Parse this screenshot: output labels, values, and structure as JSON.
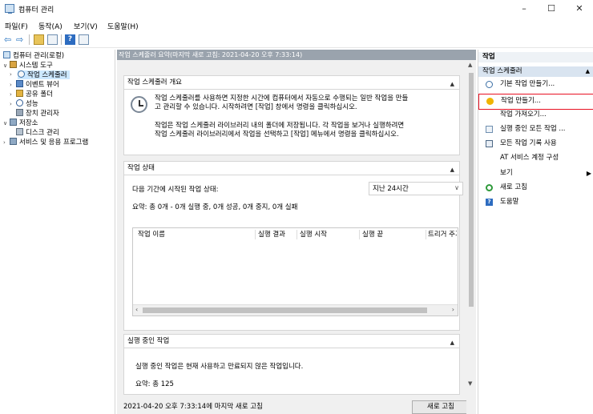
{
  "window": {
    "title": "컴퓨터 관리",
    "controls": [
      "–",
      "☐",
      "✕"
    ]
  },
  "menu": [
    "파일(F)",
    "동작(A)",
    "보기(V)",
    "도움말(H)"
  ],
  "tree": [
    {
      "label": "컴퓨터 관리(로컬)",
      "level": 0
    },
    {
      "label": "시스템 도구",
      "level": 1,
      "arrow": "∨"
    },
    {
      "label": "작업 스케줄러",
      "level": 2,
      "arrow": "›",
      "selected": true
    },
    {
      "label": "이벤트 뷰어",
      "level": 2,
      "arrow": "›"
    },
    {
      "label": "공유 폴더",
      "level": 2,
      "arrow": "›"
    },
    {
      "label": "성능",
      "level": 2,
      "arrow": "›"
    },
    {
      "label": "장치 관리자",
      "level": 2
    },
    {
      "label": "저장소",
      "level": 1,
      "arrow": "∨"
    },
    {
      "label": "디스크 관리",
      "level": 2
    },
    {
      "label": "서비스 및 응용 프로그램",
      "level": 1,
      "arrow": "›"
    }
  ],
  "center": {
    "header": "작업 스케줄러 요약(마지막 새로 고침: 2021-04-20 오후 7:33:14)",
    "overview": {
      "title": "작업 스케줄러 개요",
      "para1_line1": "작업 스케줄러를 사용하면 지정한 시간에 컴퓨터에서 자동으로 수행되는 일반 작업을 만들",
      "para1_line2": "고 관리할 수 있습니다. 시작하려면 [작업] 창에서 명령을 클릭하십시오.",
      "para2_line1": "작업은 작업 스케줄러 라이브러리 내의 폴더에 저장됩니다. 각 작업을 보거나 실행하려면",
      "para2_line2": "작업 스케줄러 라이브러리에서 작업을 선택하고 [작업] 메뉴에서 명령을 클릭하십시오."
    },
    "status": {
      "title": "작업 상태",
      "period_label": "다음 기간에 시작된 작업 상태:",
      "period_value": "지난 24시간",
      "summary": "요약: 총 0개 - 0개 실행 중, 0개 성공, 0개 중지, 0개 실패",
      "columns": [
        "작업 이름",
        "실행 결과",
        "실행 시작",
        "실행 끝",
        "트리거 주기"
      ]
    },
    "running": {
      "title": "실행 중인 작업",
      "desc": "실행 중인 작업은 현재 사용하고 만료되지 않은 작업입니다.",
      "summary": "요약: 총 125"
    },
    "footer": {
      "last_refresh": "2021-04-20 오후 7:33:14에 마지막 새로 고침",
      "refresh_button": "새로 고침"
    }
  },
  "actions": {
    "title": "작업",
    "group": "작업 스케줄러",
    "items": [
      {
        "label": "기본 작업 만들기...",
        "icon": "basic-task-icon"
      },
      {
        "label": "작업 만들기...",
        "icon": "create-task-icon",
        "highlight": true
      },
      {
        "label": "작업 가져오기...",
        "icon": ""
      },
      {
        "label": "실행 중인 모든 작업 ...",
        "icon": "running-tasks-icon"
      },
      {
        "label": "모든 작업 기록 사용",
        "icon": "history-icon"
      },
      {
        "label": "AT 서비스 계정 구성",
        "icon": ""
      },
      {
        "label": "보기",
        "icon": "",
        "submenu": true
      },
      {
        "label": "새로 고침",
        "icon": "refresh-icon"
      },
      {
        "label": "도움말",
        "icon": "help-icon"
      }
    ]
  },
  "colors": {
    "highlight": "#e81123",
    "selection": "#cce8ff",
    "group_bg": "#d9e4f0"
  }
}
